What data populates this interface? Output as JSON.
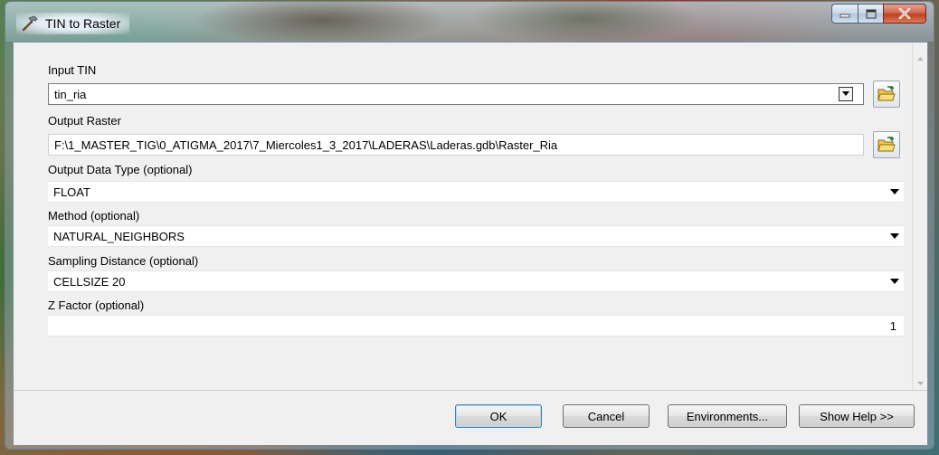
{
  "window": {
    "title": "TIN to Raster",
    "app_icon": "hammer-icon",
    "controls": [
      "minimize-icon",
      "maximize-icon",
      "close-icon"
    ]
  },
  "params": {
    "input_tin": {
      "label": "Input TIN",
      "value": "tin_ria"
    },
    "output_raster": {
      "label": "Output Raster",
      "value": "F:\\1_MASTER_TIG\\0_ATIGMA_2017\\7_Miercoles1_3_2017\\LADERAS\\Laderas.gdb\\Raster_Ria"
    },
    "output_data_type": {
      "label": "Output Data Type (optional)",
      "value": "FLOAT"
    },
    "method": {
      "label": "Method (optional)",
      "value": "NATURAL_NEIGHBORS"
    },
    "sampling_distance": {
      "label": "Sampling Distance (optional)",
      "value": "CELLSIZE 20"
    },
    "z_factor": {
      "label": "Z Factor (optional)",
      "value": "1"
    }
  },
  "buttons": {
    "ok": "OK",
    "cancel": "Cancel",
    "environments": "Environments...",
    "show_help": "Show Help >>"
  },
  "icons": {
    "browse": "open-folder-icon",
    "dropdown": "chevron-down-icon"
  }
}
